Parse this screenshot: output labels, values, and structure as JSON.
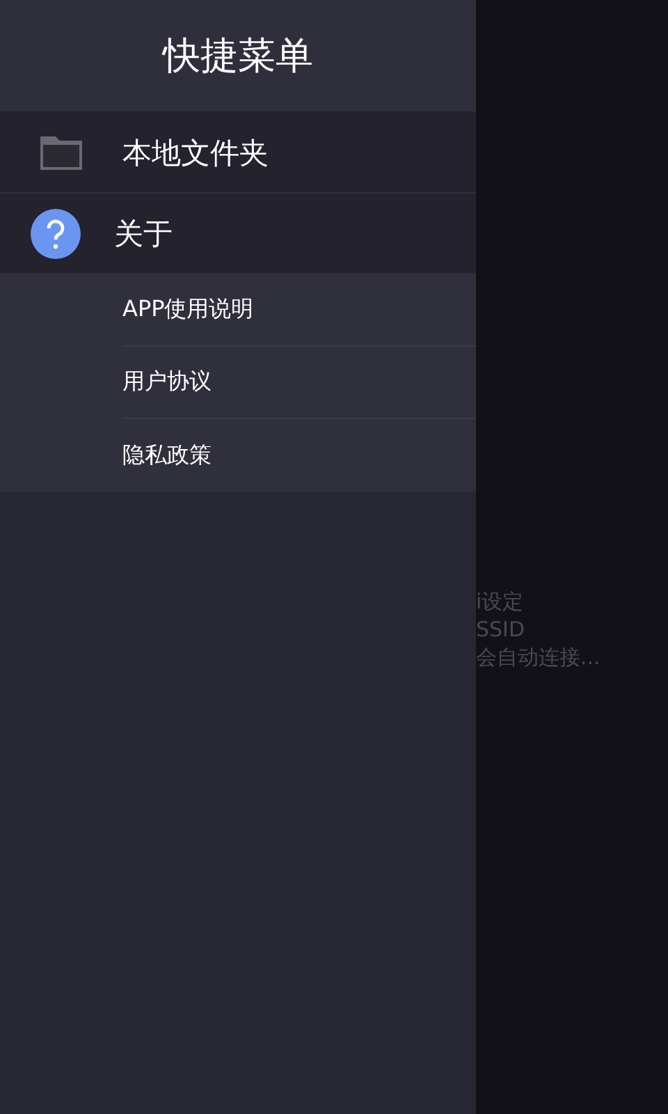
{
  "drawer": {
    "title": "快捷菜单",
    "items": [
      {
        "kind": "folder",
        "label": "本地文件夹",
        "expanded": false
      },
      {
        "kind": "help",
        "label": "关于",
        "expanded": true,
        "children": [
          {
            "label": "APP使用说明"
          },
          {
            "label": "用户协议"
          },
          {
            "label": "隐私政策"
          }
        ]
      }
    ]
  },
  "background": {
    "lines": [
      "i设定",
      "SSID",
      "会自动连接..."
    ]
  }
}
